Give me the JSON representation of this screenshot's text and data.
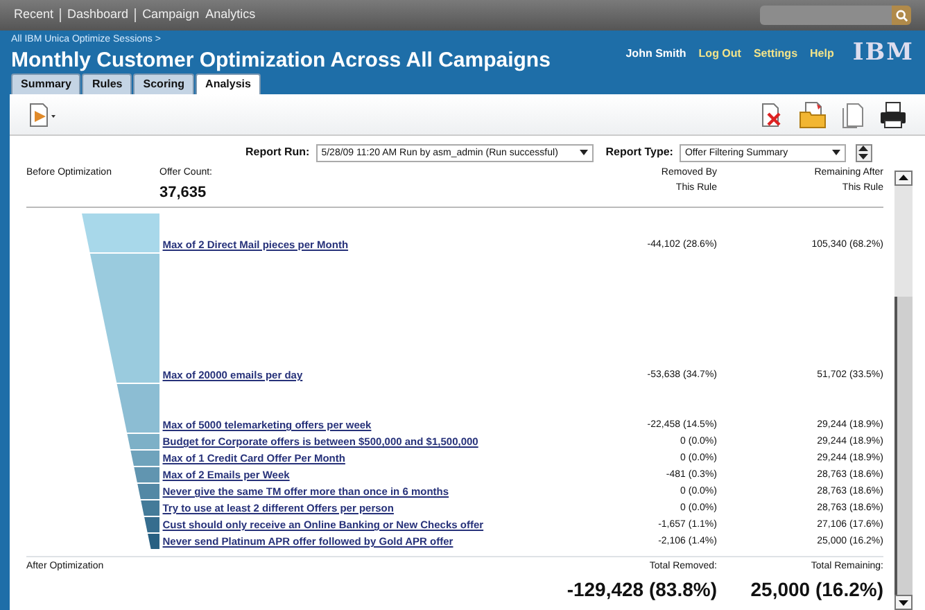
{
  "top_nav": {
    "items": [
      "Recent",
      "Dashboard",
      "Campaign",
      "Analytics"
    ]
  },
  "breadcrumb": "All IBM Unica Optimize Sessions >",
  "title": "Monthly Customer Optimization Across All Campaigns",
  "user_links": [
    "John Smith",
    "Log Out",
    "Settings",
    "Help"
  ],
  "logo": "IBM",
  "tabs": [
    {
      "label": "Summary",
      "selected": false
    },
    {
      "label": "Rules",
      "selected": false
    },
    {
      "label": "Scoring",
      "selected": false
    },
    {
      "label": "Analysis",
      "selected": true
    }
  ],
  "report_run": {
    "label": "Report Run:",
    "value": "5/28/09 11:20 AM Run by asm_admin (Run successful)"
  },
  "report_type": {
    "label": "Report Type:",
    "value": "Offer Filtering Summary"
  },
  "header": {
    "before": "Before Optimization",
    "offer_count_label": "Offer Count:",
    "offer_count": "37,635",
    "removed": "Removed By This Rule",
    "remaining": "Remaining After This Rule"
  },
  "rules": [
    {
      "name": "Max of 2 Direct Mail pieces per Month",
      "removed": "-44,102 (28.6%)",
      "remaining": "105,340 (68.2%)"
    },
    {
      "name": "Max of 20000 emails per day",
      "removed": "-53,638 (34.7%)",
      "remaining": "51,702 (33.5%)"
    },
    {
      "name": "Max of 5000 telemarketing offers per week",
      "removed": "-22,458 (14.5%)",
      "remaining": "29,244 (18.9%)"
    },
    {
      "name": "Budget for Corporate offers is between $500,000 and $1,500,000",
      "removed": "0 (0.0%)",
      "remaining": "29,244 (18.9%)"
    },
    {
      "name": "Max of 1 Credit Card Offer Per Month",
      "removed": "0 (0.0%)",
      "remaining": "29,244 (18.9%)"
    },
    {
      "name": "Max of 2 Emails per Week",
      "removed": "-481 (0.3%)",
      "remaining": "28,763 (18.6%)"
    },
    {
      "name": "Never give the same TM offer more than once in 6 months",
      "removed": "0 (0.0%)",
      "remaining": "28,763 (18.6%)"
    },
    {
      "name": "Try to use at least 2 different Offers per person",
      "removed": "0 (0.0%)",
      "remaining": "28,763 (18.6%)"
    },
    {
      "name": "Cust should only receive an Online Banking or New Checks offer",
      "removed": "-1,657 (1.1%)",
      "remaining": "27,106 (17.6%)"
    },
    {
      "name": "Never send Platinum APR offer followed by Gold APR offer",
      "removed": "-2,106 (1.4%)",
      "remaining": "25,000 (16.2%)"
    }
  ],
  "footer": {
    "after": "After Optimization",
    "total_removed_label": "Total Removed:",
    "total_removed": "-129,428 (83.8%)",
    "total_remaining_label": "Total Remaining:",
    "total_remaining": "25,000 (16.2%)"
  }
}
